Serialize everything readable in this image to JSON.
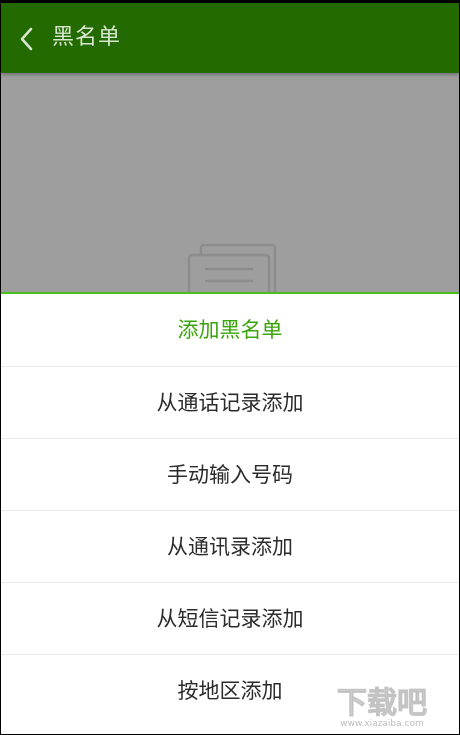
{
  "header": {
    "title": "黑名单",
    "back_icon": "back-chevron-icon",
    "background": "#236b00"
  },
  "content": {
    "empty_icon": "document-stack-icon",
    "dim_color": "#9e9e9e"
  },
  "sheet": {
    "title": "添加黑名单",
    "title_color": "#3aa40c",
    "items": [
      {
        "label": "从通话记录添加"
      },
      {
        "label": "手动输入号码"
      },
      {
        "label": "从通讯录添加"
      },
      {
        "label": "从短信记录添加"
      },
      {
        "label": "按地区添加"
      }
    ]
  },
  "watermark": {
    "text": "下载吧",
    "url": "www.xiazaiba.com"
  }
}
